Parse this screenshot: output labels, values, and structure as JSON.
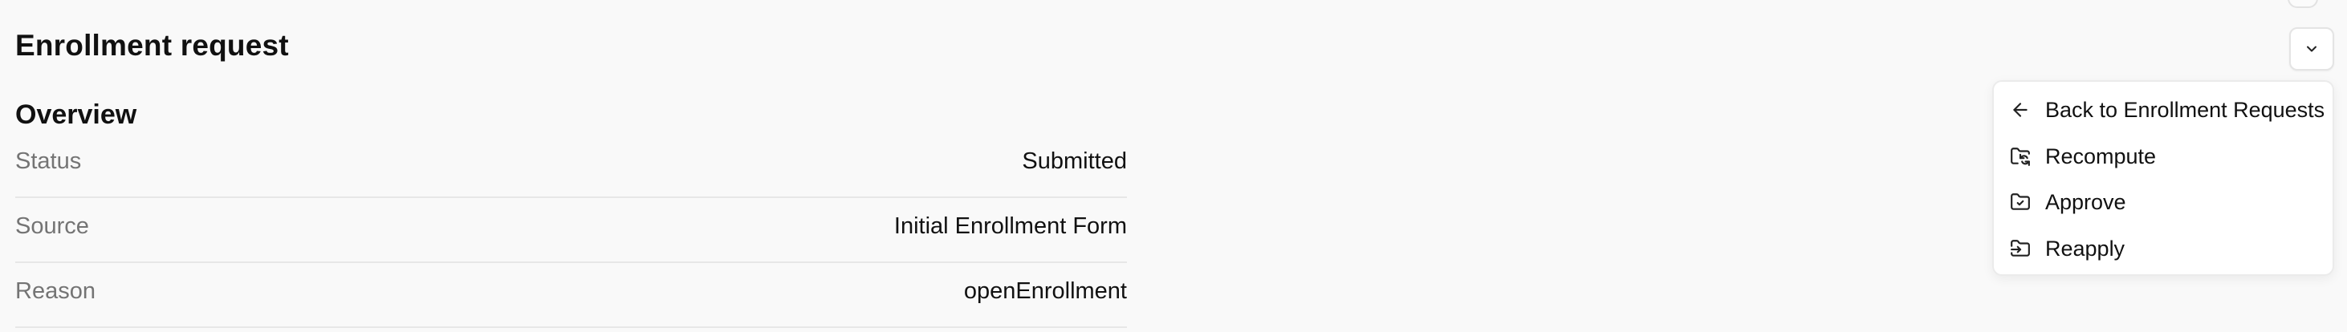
{
  "header": {
    "title": "Enrollment request"
  },
  "overview": {
    "heading": "Overview",
    "rows": [
      {
        "label": "Status",
        "value": "Submitted"
      },
      {
        "label": "Source",
        "value": "Initial Enrollment Form"
      },
      {
        "label": "Reason",
        "value": "openEnrollment"
      }
    ]
  },
  "actions_menu": {
    "toggle_icon": "chevron-down-icon",
    "items": [
      {
        "label": "Back to Enrollment Requests",
        "icon": "arrow-left-icon"
      },
      {
        "label": "Recompute",
        "icon": "folder-sync-icon"
      },
      {
        "label": "Approve",
        "icon": "folder-check-icon"
      },
      {
        "label": "Reapply",
        "icon": "folder-input-icon"
      }
    ]
  }
}
